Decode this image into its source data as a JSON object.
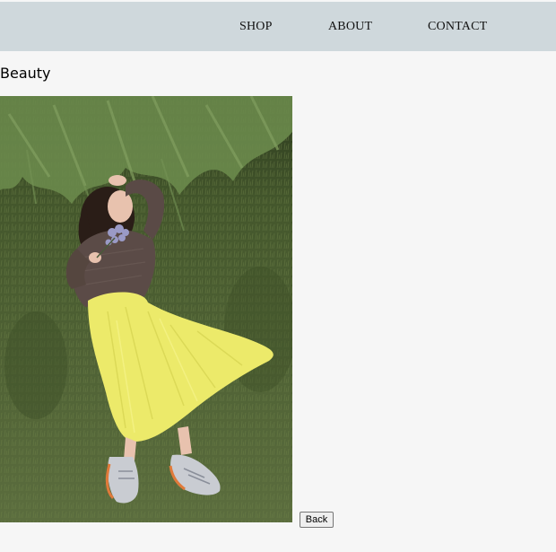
{
  "nav": {
    "shop": "SHOP",
    "about": "ABOUT",
    "contact": "CONTACT"
  },
  "page": {
    "title": "Beauty"
  },
  "photo": {
    "subject": "woman-lying-on-grass-photo",
    "alt": "Beauty"
  },
  "actions": {
    "back_label": "Back"
  },
  "colors": {
    "topbar": "#cfd8dc",
    "background": "#f6f6f6",
    "skirt": "#ecea6a",
    "grass": "#52653a"
  }
}
